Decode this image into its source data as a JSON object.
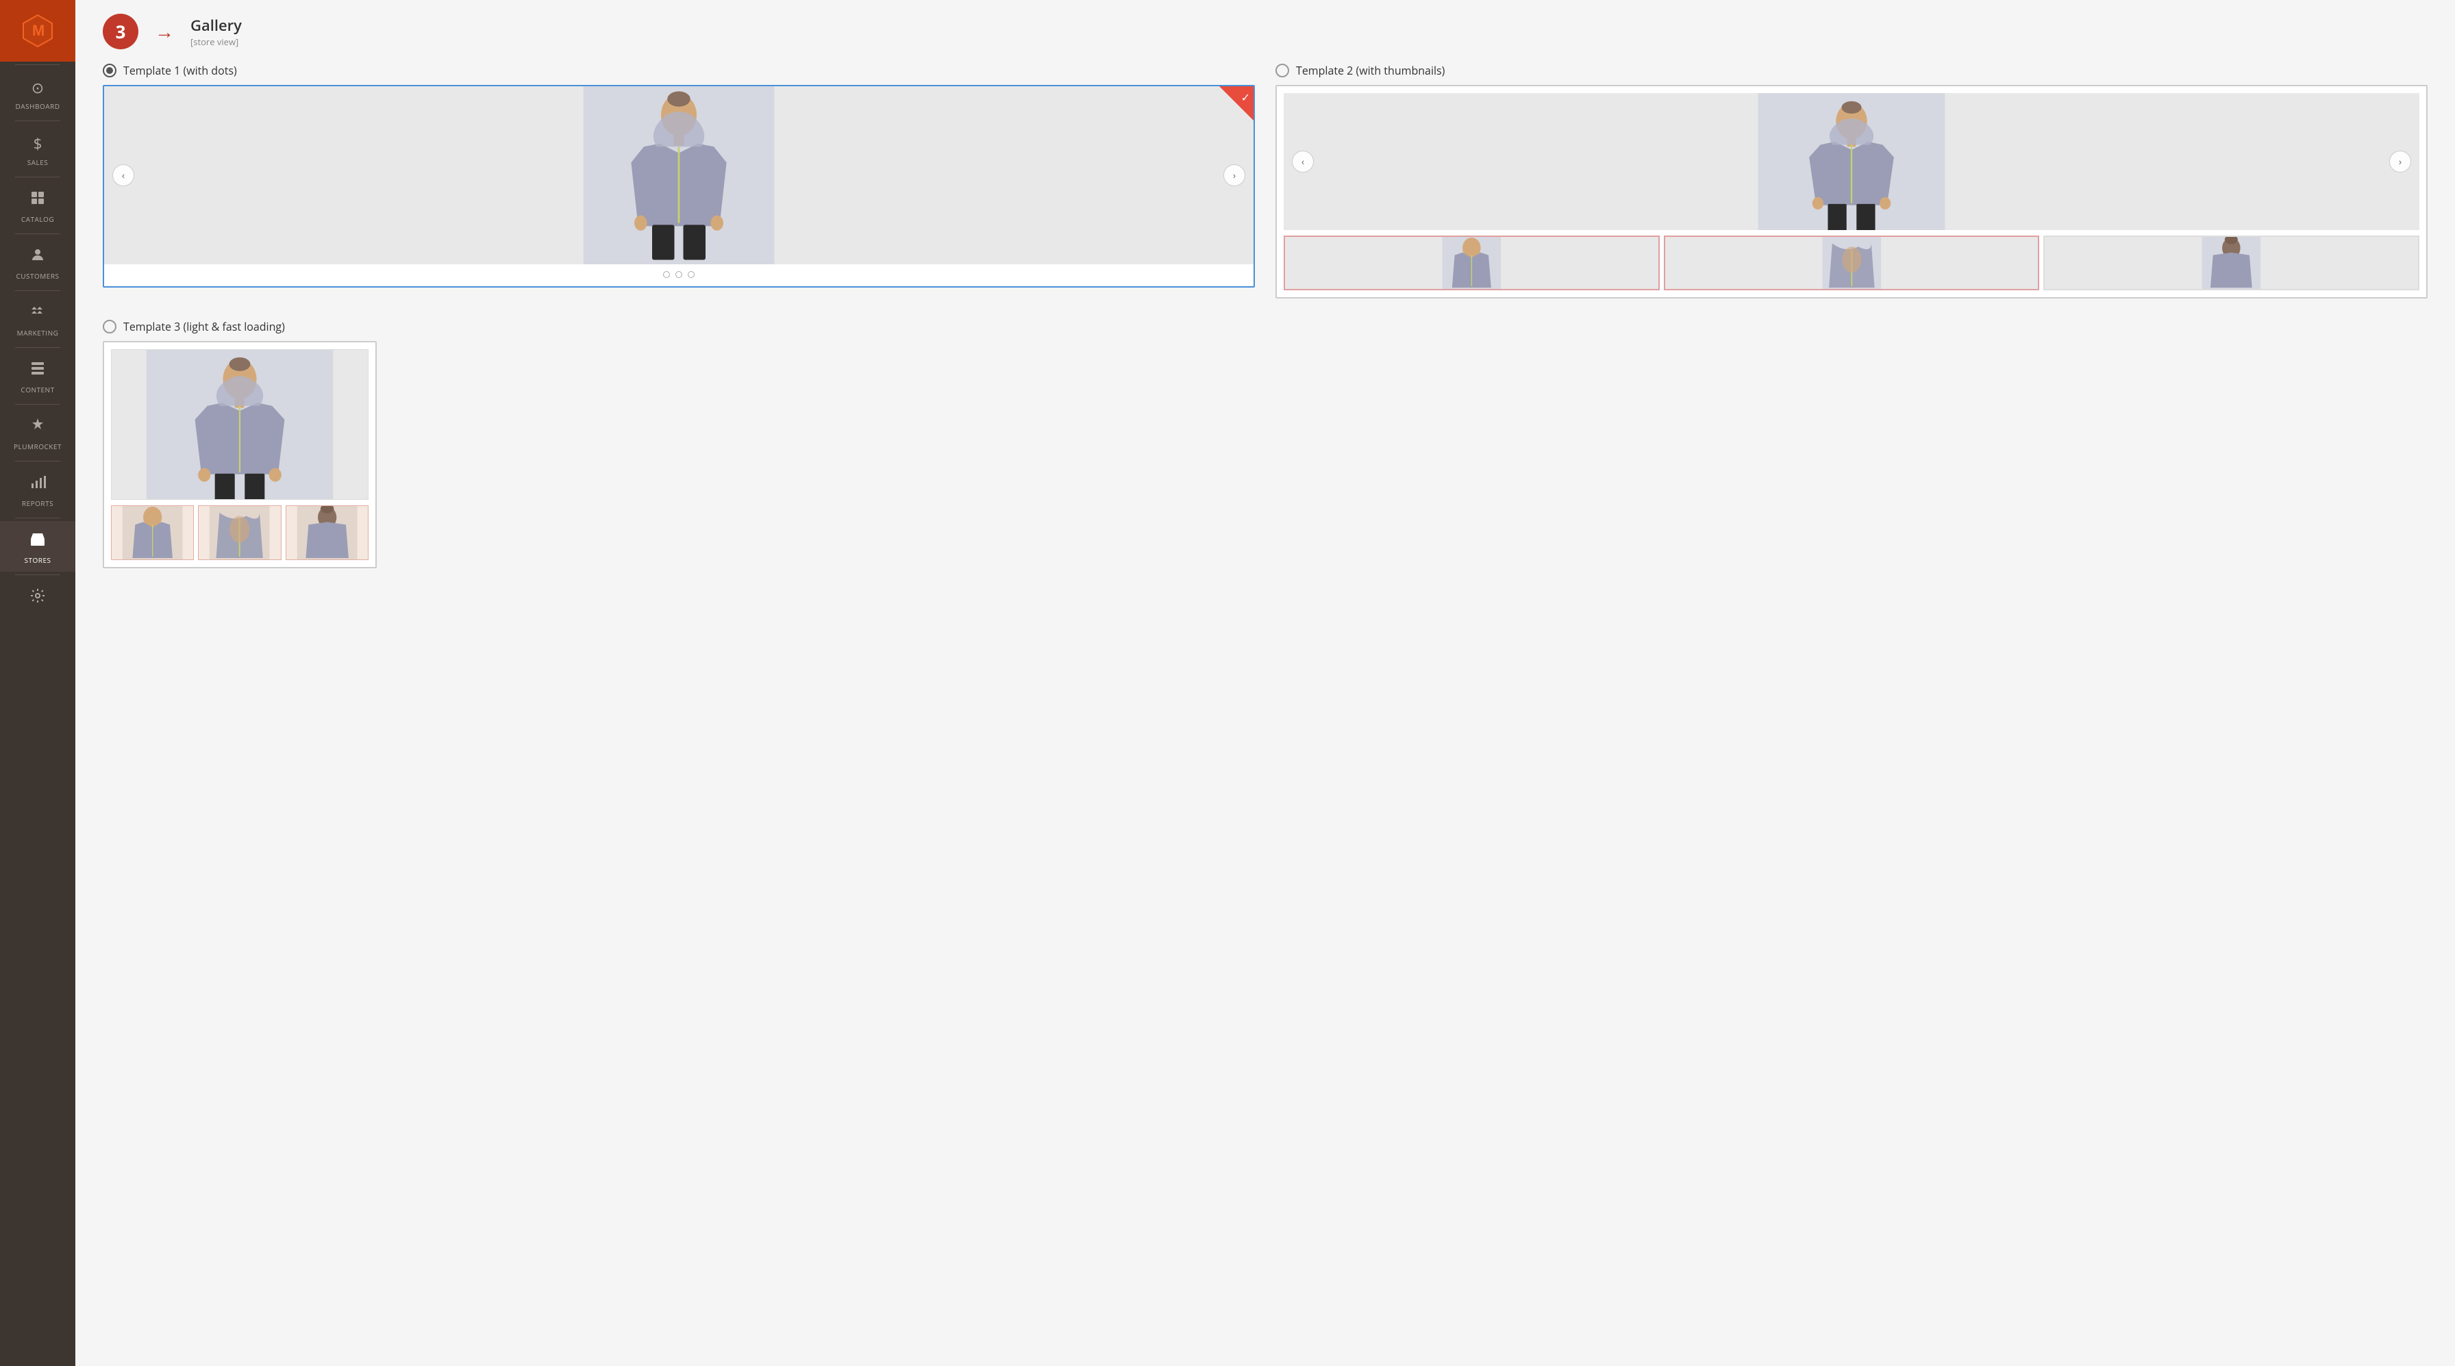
{
  "sidebar": {
    "logo_alt": "Magento",
    "items": [
      {
        "id": "dashboard",
        "label": "DASHBOARD",
        "icon": "dashboard"
      },
      {
        "id": "sales",
        "label": "SALES",
        "icon": "sales"
      },
      {
        "id": "catalog",
        "label": "CATALOG",
        "icon": "catalog"
      },
      {
        "id": "customers",
        "label": "CUSTOMERS",
        "icon": "customers"
      },
      {
        "id": "marketing",
        "label": "MARKETING",
        "icon": "marketing"
      },
      {
        "id": "content",
        "label": "CONTENT",
        "icon": "content"
      },
      {
        "id": "plumrocket",
        "label": "PLUMROCKET",
        "icon": "plumrocket"
      },
      {
        "id": "reports",
        "label": "REPORTS",
        "icon": "reports"
      },
      {
        "id": "stores",
        "label": "STORES",
        "icon": "stores",
        "active": true
      },
      {
        "id": "system",
        "label": "",
        "icon": "system"
      }
    ]
  },
  "page": {
    "step_number": "3",
    "step_title": "Gallery",
    "step_subtitle": "[store view]",
    "templates": [
      {
        "id": "template1",
        "label": "Template 1 (with dots)",
        "selected": true
      },
      {
        "id": "template2",
        "label": "Template 2 (with thumbnails)",
        "selected": false
      },
      {
        "id": "template3",
        "label": "Template 3 (light & fast loading)",
        "selected": false
      }
    ]
  }
}
